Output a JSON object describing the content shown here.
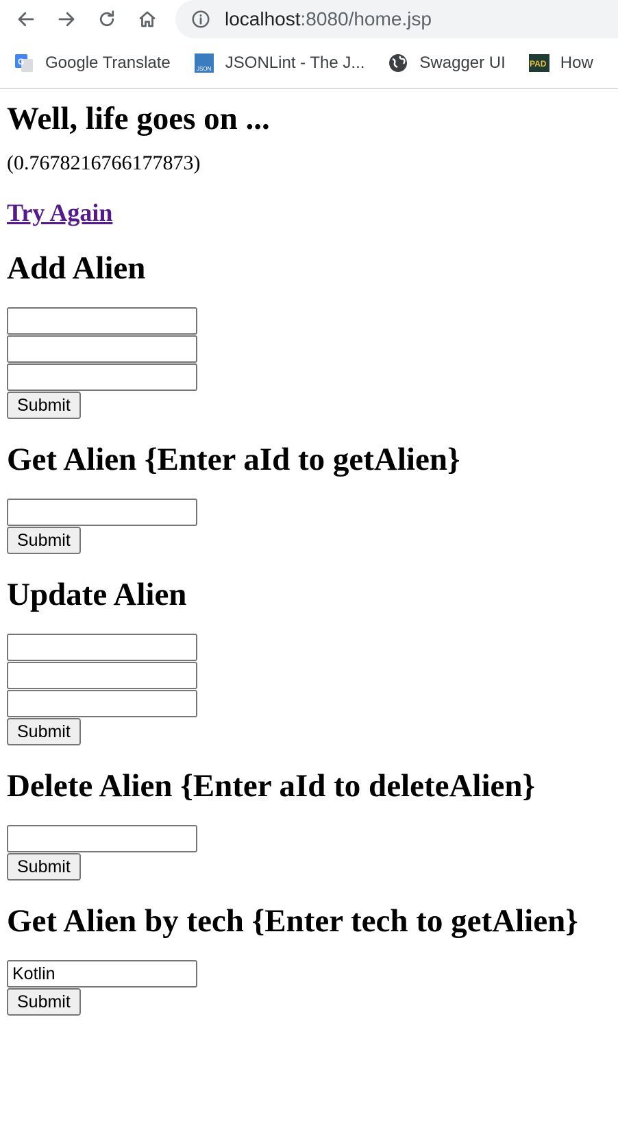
{
  "browser": {
    "url_host": "localhost",
    "url_path": ":8080/home.jsp",
    "bookmarks": [
      {
        "label": "Google Translate",
        "icon": "google-translate-icon"
      },
      {
        "label": "JSONLint - The J...",
        "icon": "jsonlint-icon",
        "badge": "JSON"
      },
      {
        "label": "Swagger UI",
        "icon": "globe-icon"
      },
      {
        "label": "How",
        "icon": "pad-icon",
        "badge": "PAD"
      }
    ]
  },
  "page": {
    "title": "Well, life goes on ...",
    "random_value": "(0.7678216766177873)",
    "try_again": "Try Again",
    "sections": {
      "add": {
        "heading": "Add Alien",
        "submit": "Submit"
      },
      "get": {
        "heading": "Get Alien {Enter aId to getAlien}",
        "submit": "Submit"
      },
      "update": {
        "heading": "Update Alien",
        "submit": "Submit"
      },
      "delete": {
        "heading": "Delete Alien {Enter aId to deleteAlien}",
        "submit": "Submit"
      },
      "by_tech": {
        "heading": "Get Alien by tech {Enter tech to getAlien}",
        "submit": "Submit",
        "value": "Kotlin"
      }
    }
  },
  "colors": {
    "link_visited": "#551a8b",
    "omnibox_bg": "#f1f3f4"
  }
}
